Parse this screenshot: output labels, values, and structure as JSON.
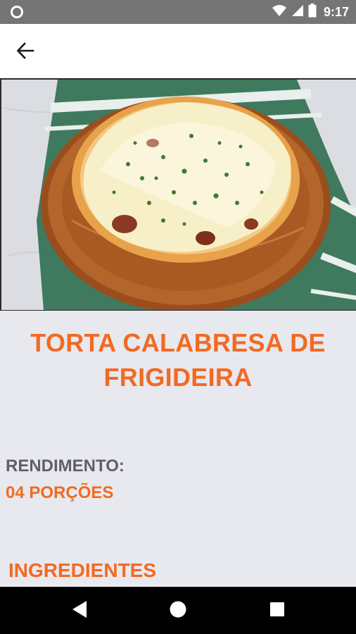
{
  "status_bar": {
    "time": "9:17",
    "icons": [
      "notification-circle-icon",
      "wifi-icon",
      "cellular-signal-icon",
      "battery-icon"
    ]
  },
  "app_bar": {
    "back_icon": "arrow-left-icon"
  },
  "recipe": {
    "title": "TORTA CALABRESA DE FRIGIDEIRA",
    "yield_label": "RENDIMENTO:",
    "yield_value": "04 PORÇÕES",
    "ingredients_heading": "INGREDIENTES"
  },
  "nav_bar": {
    "icons": [
      "back-triangle-icon",
      "home-circle-icon",
      "recents-square-icon"
    ]
  },
  "colors": {
    "accent": "#f26a22",
    "label_gray": "#5f5f66",
    "background": "#e8e8ef",
    "status_bar": "#757575"
  }
}
